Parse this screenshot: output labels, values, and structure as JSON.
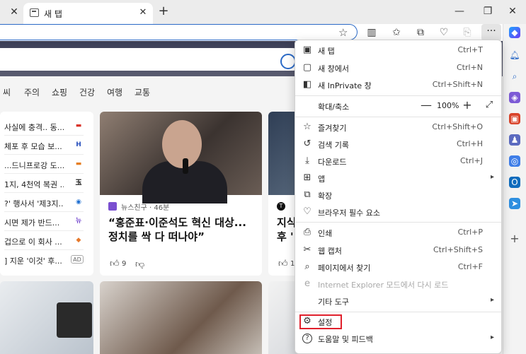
{
  "tab": {
    "title": "새 탭",
    "close_glyph": "✕"
  },
  "titlebar": {
    "left_close_glyph": "✕",
    "new_tab_glyph": "+",
    "min_glyph": "—",
    "restore_glyph": "❐",
    "close_glyph": "✕"
  },
  "toolbar": {
    "more_glyph": "···"
  },
  "nav": [
    "씨",
    "주의",
    "쇼핑",
    "건강",
    "여행",
    "교통"
  ],
  "news_list": [
    {
      "title": "사실에 충격.. 동...",
      "source_color": "#d9342b",
      "source_glyph": "▬"
    },
    {
      "title": "체포 후 모습 보...",
      "source_color": "#2a52be",
      "source_glyph": "H"
    },
    {
      "title": "...드니프로강 도...",
      "source_color": "#e67e22",
      "source_glyph": "▬"
    },
    {
      "title": "1지, 4천억 복권 ...",
      "source_color": "#111111",
      "source_glyph": "玉"
    },
    {
      "title": "?' 행사서 '제3지...",
      "source_color": "#1f6fd1",
      "source_glyph": "◉"
    },
    {
      "title": "시면 제가 반드...",
      "source_color": "#7a4fd0",
      "source_glyph": "뉴"
    },
    {
      "title": "겁으로 이 회사 ...",
      "source_color": "#e6782a",
      "source_glyph": "◆"
    },
    {
      "title": "] 지운 '이것' 후...",
      "source_color": "#666666",
      "source_glyph": "AD"
    }
  ],
  "featured": {
    "source": "뉴스친구 · 46분",
    "headline_line1": "“홍준표·이준석도 혁신 대상...",
    "headline_line2": "정치를 싹 다 떠나야”",
    "likes": "9"
  },
  "featured2": {
    "source_prefix": "T",
    "headline_line1": "지식",
    "headline_line2": "후 '",
    "likes": "1"
  },
  "menu": {
    "items": [
      {
        "name": "new-tab",
        "icon": "▣",
        "label": "새 탭",
        "shortcut": "Ctrl+T"
      },
      {
        "name": "new-window",
        "icon": "▢",
        "label": "새 창에서",
        "shortcut": "Ctrl+N"
      },
      {
        "name": "new-inprivate",
        "icon": "◧",
        "label": "새 InPrivate 창",
        "shortcut": "Ctrl+Shift+N"
      },
      {
        "name": "favorites",
        "icon": "☆",
        "label": "즐겨찾기",
        "shortcut": "Ctrl+Shift+O"
      },
      {
        "name": "history",
        "icon": "↺",
        "label": "검색 기록",
        "shortcut": "Ctrl+H"
      },
      {
        "name": "downloads",
        "icon": "⤓",
        "label": "다운로드",
        "shortcut": "Ctrl+J"
      },
      {
        "name": "apps",
        "icon": "⊞",
        "label": "앱",
        "shortcut": ""
      },
      {
        "name": "extensions",
        "icon": "⧉",
        "label": "확장",
        "shortcut": ""
      },
      {
        "name": "browser-essentials",
        "icon": "♡",
        "label": "브라우저 필수 요소",
        "shortcut": ""
      },
      {
        "name": "print",
        "icon": "⎙",
        "label": "인쇄",
        "shortcut": "Ctrl+P"
      },
      {
        "name": "web-capture",
        "icon": "✂",
        "label": "웹 캡처",
        "shortcut": "Ctrl+Shift+S"
      },
      {
        "name": "find-on-page",
        "icon": "⌕",
        "label": "페이지에서 찾기",
        "shortcut": "Ctrl+F"
      },
      {
        "name": "ie-mode",
        "icon": "e",
        "label": "Internet Explorer 모드에서 다시 로드",
        "shortcut": ""
      },
      {
        "name": "more-tools",
        "icon": "",
        "label": "기타 도구",
        "shortcut": ""
      },
      {
        "name": "settings",
        "icon": "⚙",
        "label": "설정",
        "shortcut": ""
      },
      {
        "name": "help-feedback",
        "icon": "?",
        "label": "도움말 및 피드백",
        "shortcut": ""
      }
    ],
    "zoom": {
      "label": "확대/축소",
      "value": "100%",
      "minus": "—",
      "plus": "+",
      "fullscreen": "⤢"
    },
    "submenu_arrow": "▸"
  },
  "highlight_color": "#e0202c"
}
